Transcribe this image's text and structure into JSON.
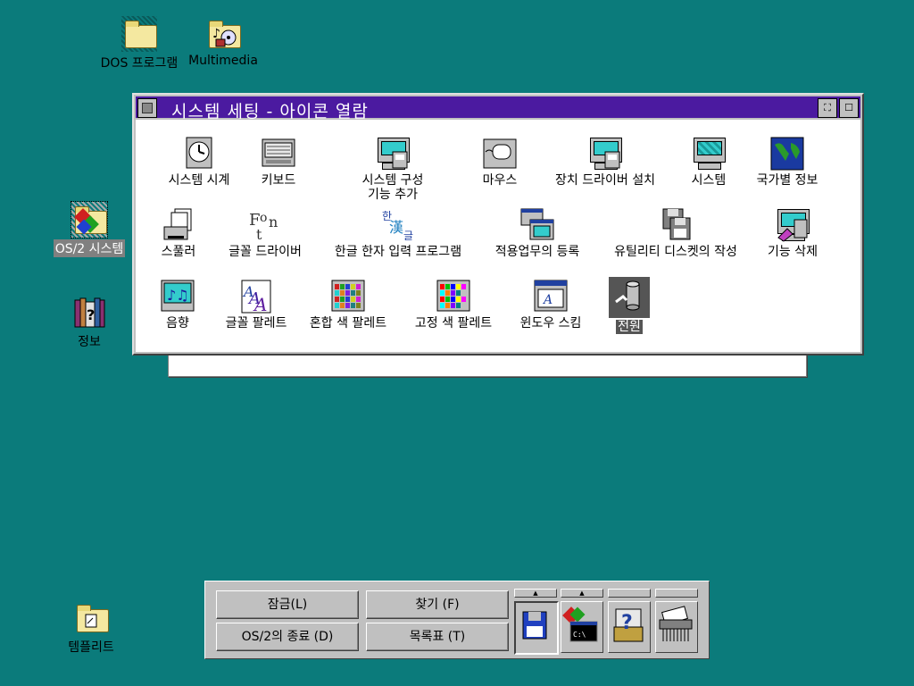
{
  "desktop": {
    "icons": [
      {
        "label": "DOS 프로그램",
        "icon": "folder-icon"
      },
      {
        "label": "Multimedia",
        "icon": "multimedia-folder-icon"
      },
      {
        "label": "OS/2 시스템",
        "icon": "system-folder-icon",
        "selected": true
      },
      {
        "label": "정보",
        "icon": "books-info-icon"
      },
      {
        "label": "템플리트",
        "icon": "templates-folder-icon"
      }
    ]
  },
  "window": {
    "title": "시스템 세팅 - 아이콘 열람",
    "icons": [
      {
        "label": "시스템 시계",
        "icon": "clock-icon"
      },
      {
        "label": "키보드",
        "icon": "keyboard-icon"
      },
      {
        "label": "시스템 구성\n기능 추가",
        "icon": "selective-install-icon"
      },
      {
        "label": "마우스",
        "icon": "mouse-icon"
      },
      {
        "label": "장치 드라이버 설치",
        "icon": "device-driver-install-icon"
      },
      {
        "label": "시스템",
        "icon": "system-monitor-icon"
      },
      {
        "label": "국가별 정보",
        "icon": "country-map-icon"
      },
      {
        "label": "스풀러",
        "icon": "spooler-printer-icon"
      },
      {
        "label": "글꼴 드라이버",
        "icon": "font-icon"
      },
      {
        "label": "한글 한자 입력 프로그램",
        "icon": "hangul-hanja-icon"
      },
      {
        "label": "적용업무의 등록",
        "icon": "migrate-apps-icon"
      },
      {
        "label": "유틸리티 디스켓의 작성",
        "icon": "utility-diskette-icon"
      },
      {
        "label": "기능 삭제",
        "icon": "selective-uninstall-icon"
      },
      {
        "label": "음향",
        "icon": "sound-icon"
      },
      {
        "label": "글꼴 팔레트",
        "icon": "font-palette-icon"
      },
      {
        "label": "혼합 색 팔레트",
        "icon": "mixed-color-palette-icon"
      },
      {
        "label": "고정 색 팔레트",
        "icon": "solid-color-palette-icon"
      },
      {
        "label": "윈도우 스킴",
        "icon": "scheme-palette-icon"
      },
      {
        "label": "전원",
        "icon": "power-icon",
        "selected": true
      }
    ]
  },
  "launchpad": {
    "buttons": {
      "lockup": "잠금(L)",
      "find": "찾기 (F)",
      "shutdown": "OS/2의 종료 (D)",
      "window_list": "목록표 (T)"
    },
    "tools": [
      {
        "icon": "diskette-icon",
        "pressed": true
      },
      {
        "icon": "os2-command-prompt-icon"
      },
      {
        "icon": "help-icon"
      },
      {
        "icon": "shredder-icon"
      }
    ],
    "drawer_arrow": "▲"
  }
}
